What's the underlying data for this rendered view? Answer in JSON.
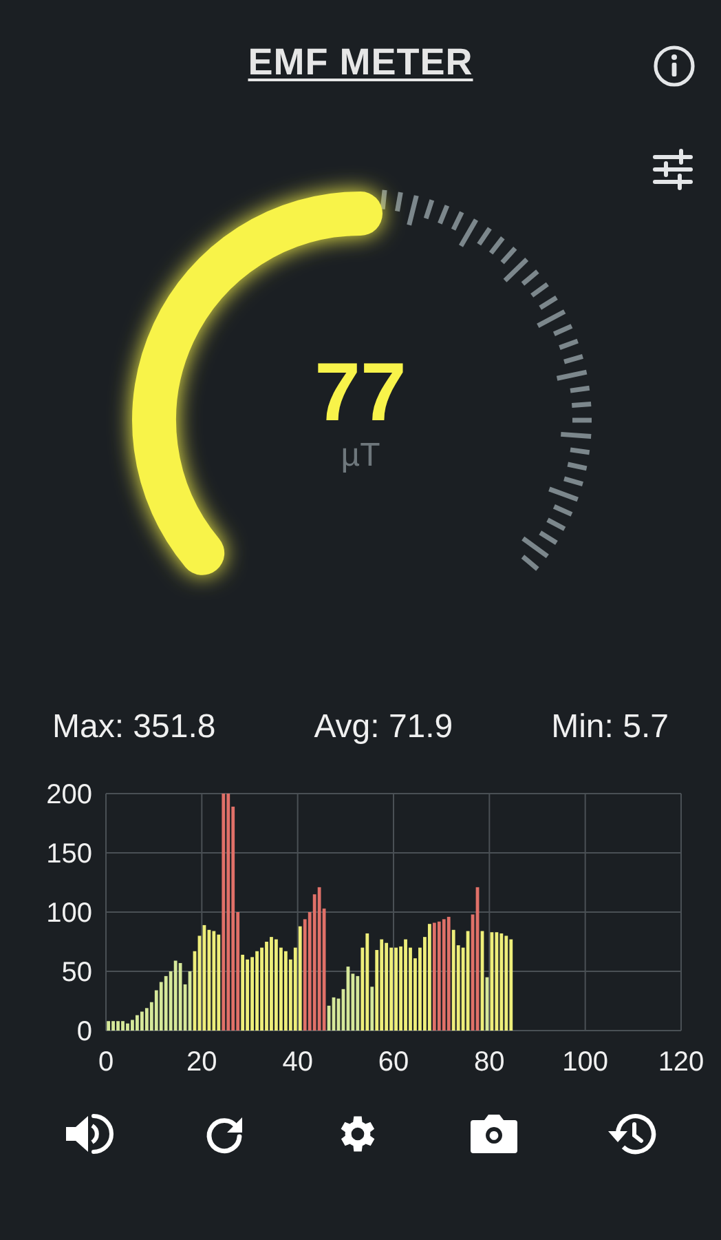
{
  "header": {
    "title": "EMF METER"
  },
  "gauge": {
    "value": "77",
    "unit": "µT"
  },
  "stats": [
    {
      "text": "Max: 351.8"
    },
    {
      "text": "Avg: 71.9"
    },
    {
      "text": "Min: 5.7"
    }
  ],
  "chart_data": {
    "type": "bar",
    "grid": true,
    "x": [
      0,
      1,
      2,
      3,
      4,
      5,
      6,
      7,
      8,
      9,
      10,
      11,
      12,
      13,
      14,
      15,
      16,
      17,
      18,
      19,
      20,
      21,
      22,
      23,
      24,
      25,
      26,
      27,
      28,
      29,
      30,
      31,
      32,
      33,
      34,
      35,
      36,
      37,
      38,
      39,
      40,
      41,
      42,
      43,
      44,
      45,
      46,
      47,
      48,
      49,
      50,
      51,
      52,
      53,
      54,
      55,
      56,
      57,
      58,
      59,
      60,
      61,
      62,
      63,
      64,
      65,
      66,
      67,
      68,
      69,
      70,
      71,
      72,
      73,
      74,
      75,
      76,
      77,
      78,
      79,
      80,
      81,
      82,
      83,
      84
    ],
    "xlim": [
      0,
      120
    ],
    "ylim": [
      0,
      200
    ],
    "xticks": [
      0,
      20,
      40,
      60,
      80,
      100,
      120
    ],
    "yticks": [
      0,
      50,
      100,
      150,
      200
    ],
    "series": [
      {
        "color": "#d6e89a",
        "values": [
          8,
          8,
          8,
          8,
          6,
          9,
          13,
          16,
          19,
          24,
          34,
          41,
          46,
          50,
          59,
          57,
          39,
          50,
          null,
          null,
          null,
          null,
          null,
          null,
          null,
          null,
          null,
          null,
          null,
          null,
          null,
          null,
          null,
          null,
          null,
          null,
          null,
          null,
          null,
          null,
          null,
          null,
          null,
          null,
          null,
          null,
          21,
          28,
          27,
          35,
          54,
          48,
          46,
          null,
          null,
          37,
          null,
          null,
          null,
          null,
          null,
          null,
          null,
          null,
          null,
          null,
          null,
          null,
          null,
          null,
          null,
          null,
          null,
          null,
          null,
          null,
          null,
          null,
          null,
          45,
          null,
          null,
          null,
          null,
          null
        ]
      },
      {
        "color": "#eeee7a",
        "values": [
          null,
          null,
          null,
          null,
          null,
          null,
          null,
          null,
          null,
          null,
          null,
          null,
          null,
          null,
          null,
          null,
          null,
          null,
          67,
          80,
          89,
          85,
          84,
          81,
          null,
          null,
          null,
          null,
          64,
          60,
          62,
          67,
          70,
          75,
          79,
          77,
          70,
          67,
          60,
          70,
          88,
          null,
          null,
          null,
          null,
          null,
          null,
          null,
          null,
          null,
          null,
          null,
          null,
          70,
          82,
          null,
          68,
          77,
          74,
          70,
          70,
          71,
          77,
          70,
          61,
          70,
          79,
          90,
          null,
          null,
          null,
          null,
          85,
          72,
          70,
          84,
          null,
          null,
          84,
          null,
          83,
          83,
          82,
          80,
          77
        ]
      },
      {
        "color": "#e07068",
        "values": [
          null,
          null,
          null,
          null,
          null,
          null,
          null,
          null,
          null,
          null,
          null,
          null,
          null,
          null,
          null,
          null,
          null,
          null,
          null,
          null,
          null,
          null,
          null,
          null,
          200,
          200,
          189,
          100,
          null,
          null,
          null,
          null,
          null,
          null,
          null,
          null,
          null,
          null,
          null,
          null,
          null,
          94,
          100,
          115,
          121,
          103,
          null,
          null,
          null,
          null,
          null,
          null,
          null,
          null,
          null,
          null,
          null,
          null,
          null,
          null,
          null,
          null,
          null,
          null,
          null,
          null,
          null,
          null,
          91,
          92,
          94,
          96,
          null,
          null,
          null,
          null,
          98,
          121,
          null,
          null,
          null,
          null,
          null,
          null,
          null
        ]
      }
    ]
  }
}
